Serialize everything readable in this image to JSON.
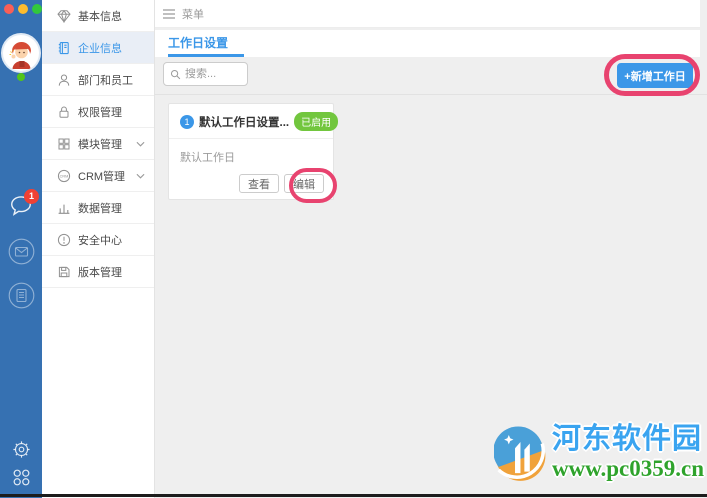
{
  "colors": {
    "rail_blue": "#3671b2",
    "accent_blue": "#3b97e8",
    "status_green": "#72c63e",
    "annotation_pink": "#e8436f",
    "notification_red": "#f04134",
    "watermark_blue": "#3aa4f0",
    "watermark_green": "#2fa32c"
  },
  "rail": {
    "badge_count": "1",
    "icons": [
      "avatar",
      "online-dot",
      "chat",
      "mail",
      "document",
      "gear",
      "apps"
    ]
  },
  "sidebar": {
    "items": [
      {
        "label": "基本信息",
        "icon": "gem-icon",
        "selected": false
      },
      {
        "label": "企业信息",
        "icon": "notebook-icon",
        "selected": true
      },
      {
        "label": "部门和员工",
        "icon": "user-icon",
        "selected": false
      },
      {
        "label": "权限管理",
        "icon": "lock-icon",
        "selected": false
      },
      {
        "label": "模块管理",
        "icon": "grid-icon",
        "selected": false,
        "chevron": true
      },
      {
        "label": "CRM管理",
        "icon": "crm-icon",
        "icon_text": "CRM",
        "selected": false,
        "chevron": true
      },
      {
        "label": "数据管理",
        "icon": "bar-chart-icon",
        "selected": false
      },
      {
        "label": "安全中心",
        "icon": "alert-icon",
        "selected": false
      },
      {
        "label": "版本管理",
        "icon": "floppy-icon",
        "selected": false
      }
    ]
  },
  "header": {
    "menu_label": "菜单"
  },
  "tabs": {
    "active": "工作日设置"
  },
  "toolbar": {
    "search_placeholder": "搜索...",
    "add_button": "+新增工作日"
  },
  "card": {
    "index": "1",
    "title": "默认工作日设置...",
    "status": "已启用",
    "body": "默认工作日",
    "view_button": "查看",
    "edit_button": "编辑"
  },
  "watermark": {
    "site_name": "河东软件园",
    "site_url": "www.pc0359.cn"
  }
}
